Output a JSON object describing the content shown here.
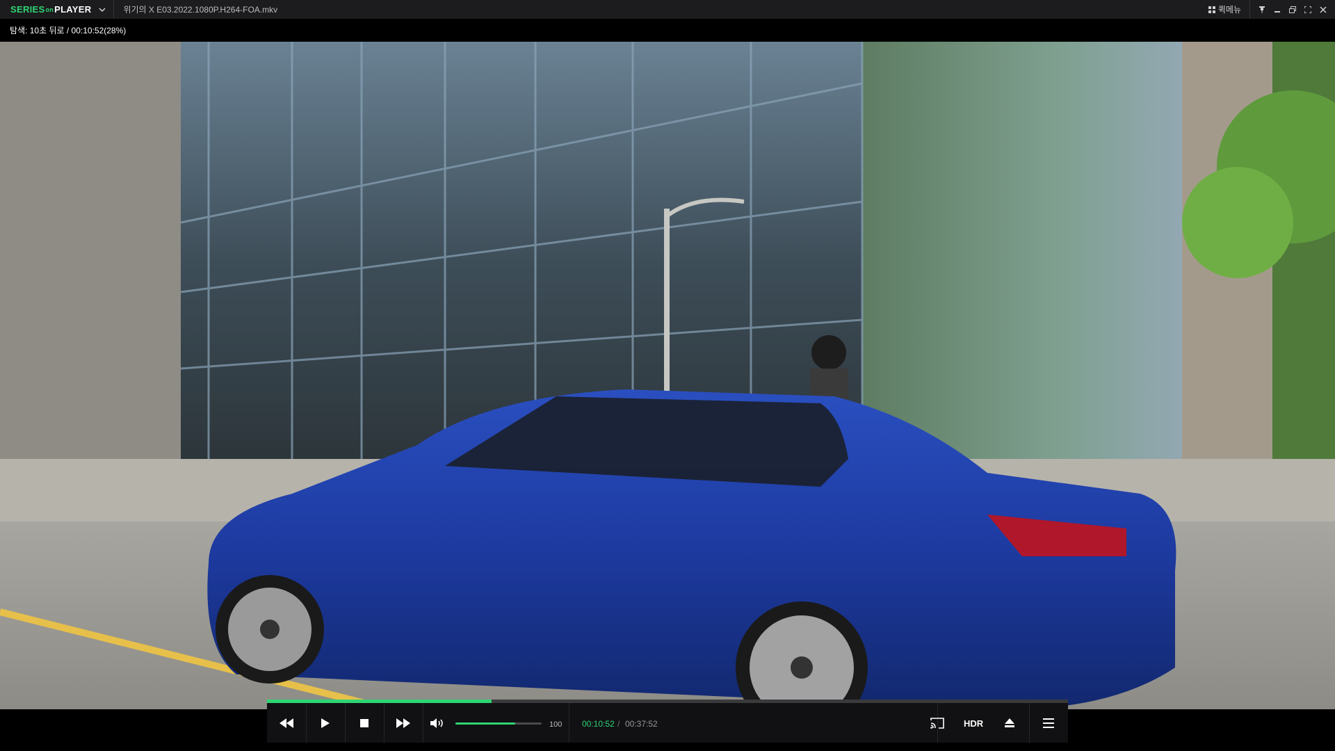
{
  "app": {
    "logo": {
      "part1": "SERIES",
      "part2": "on",
      "part3": "PLAYER"
    },
    "filename": "위기의 X E03.2022.1080P.H264-FOA.mkv",
    "quick_menu_label": "퀵메뉴"
  },
  "osd": {
    "message": "탐색: 10초 뒤로 / 00:10:52(28%)"
  },
  "playback": {
    "progress": 0.28,
    "volume_value": "100",
    "volume_fraction": 0.69,
    "current_time": "00:10:52",
    "separator": "/",
    "total_time": "00:37:52",
    "hdr_label": "HDR"
  },
  "icons": {
    "logo_menu": "chevron-down-icon",
    "quick_menu": "grid-icon",
    "pin": "pin-icon",
    "minimize": "minimize-icon",
    "restore": "restore-icon",
    "fullscreen": "expand-icon",
    "close": "close-icon",
    "rewind": "rewind-icon",
    "play": "play-icon",
    "stop": "stop-icon",
    "forward": "fast-forward-icon",
    "volume": "volume-icon",
    "cast": "cast-icon",
    "eject": "eject-icon",
    "menu": "hamburger-menu-icon"
  },
  "colors": {
    "accent": "#2ed573",
    "titlebar_bg": "#1c1c1e",
    "controls_bg": "#111113"
  }
}
